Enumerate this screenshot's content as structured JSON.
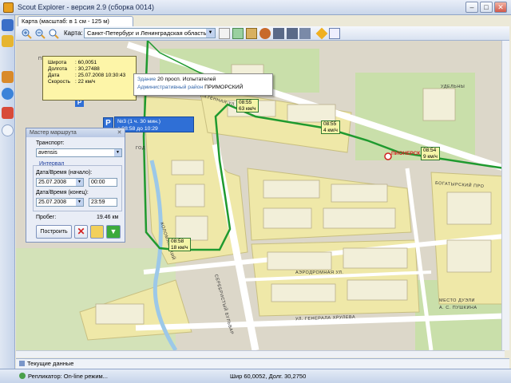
{
  "window": {
    "title": "Scout Explorer - версия 2.9 (сборка 0014)",
    "min_glyph": "–",
    "max_glyph": "□",
    "close_glyph": "✕"
  },
  "map_tab": {
    "label": "Карта (масштаб: в 1 см - 125 м)"
  },
  "toolbar": {
    "map_label": "Карта:",
    "map_select_value": "Санкт-Петербург и Ленинградская область"
  },
  "info_popup": {
    "rows": [
      {
        "k": "Широта",
        "v": ": 60,0051"
      },
      {
        "k": "Долгота",
        "v": ": 30,27488"
      },
      {
        "k": "Дата",
        "v": ": 25.07.2008 10:30:43"
      },
      {
        "k": "Скорость",
        "v": ": 22 км/ч"
      }
    ]
  },
  "speed_tags": [
    {
      "time": "08:55",
      "speed": "63 км/ч"
    },
    {
      "time": "08:55",
      "speed": "4 км/ч"
    },
    {
      "time": "08:54",
      "speed": "9 км/ч"
    },
    {
      "time": "08:58",
      "speed": "18 км/ч"
    }
  ],
  "building_tip": {
    "line1_key": "Здание",
    "line1_val": "20 просп. Испытателей",
    "line2_key": "Административный район",
    "line2_val": "ПРИМОРСКИЙ"
  },
  "stop_tag": {
    "line1": "№3 (1 ч. 30 мин.)",
    "line2": "с 08:58 до 10:29"
  },
  "parking_label": "P",
  "metro_label": "ПИОНЕРСК",
  "streets": [
    "ПРОСП.",
    "УДЕЛЬНЫ",
    "БОГАТЫРСКИЙ ПРО",
    "ЯХТЕННАЯ УЛ.",
    "СЕРЕБРИСТЫЙ БУЛЬВАР",
    "АЭРОДРОМНАЯ УЛ.",
    "УЛ. ГЕНЕРАЛА ХРУЛЕВА",
    "ГОД",
    "МЕСТО ДУЭЛИ",
    "А. С. ПУШКИНА",
    "КОЛОМЯЖСКИЙ"
  ],
  "wizard": {
    "title": "Мастер маршрута",
    "transport_label": "Транспорт:",
    "transport_value": "avensis",
    "interval_label": "Интервал",
    "start_label": "Дата/Время (начало):",
    "start_date": "25.07.2008",
    "start_time": "00:00",
    "end_label": "Дата/Время (конец):",
    "end_date": "25.07.2008",
    "end_time": "23:59",
    "mileage_label": "Пробег:",
    "mileage_value": "19.46 км",
    "build_button": "Построить"
  },
  "bottom_tab": {
    "label": "Текущие данные"
  },
  "status": {
    "replicator": "Репликатор: On-line режим...",
    "coords": "Шир 60,0052, Долг. 30,2750"
  },
  "colors": {
    "route": "#1f9a2f",
    "river": "#9cc8e8",
    "park": "#c8dfa8",
    "block": "#efe8a8",
    "road": "#ffffff",
    "metro": "#d22020",
    "parking": "#2f6fd6"
  }
}
